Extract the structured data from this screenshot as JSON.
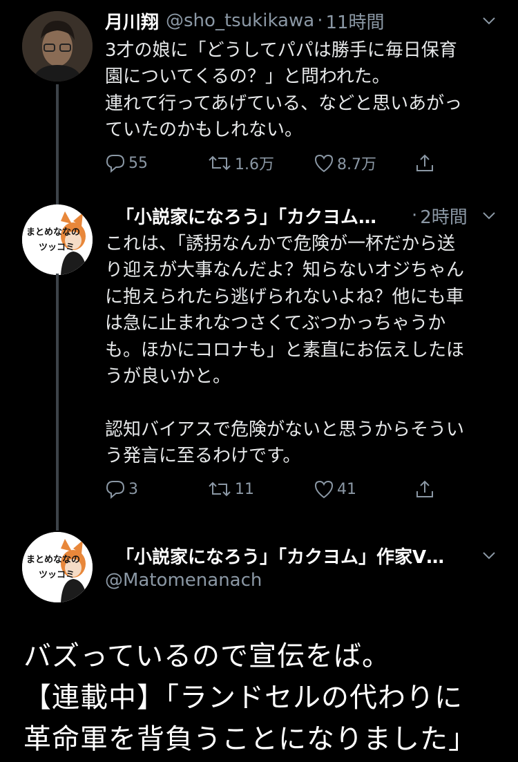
{
  "tweets": [
    {
      "display_name": "月川翔",
      "handle": "@sho_tsukikawa",
      "time": "11時間",
      "body": "3才の娘に「どうしてパパは勝手に毎日保育\n園についてくるの？」と問われた。\n連れて行ってあげている、などと思いあがっ\nていたのかもしれない。",
      "replies": "55",
      "retweets": "1.6万",
      "likes": "8.7万"
    },
    {
      "display_name": "「小説家になろう」「カクヨム…",
      "time": "2時間",
      "body": "これは、「誘拐なんかで危険が一杯だから送\nり迎えが大事なんだよ？知らないオジちゃん\nに抱えられたら逃げられないよね？他にも車\nは急に止まれなつさくてぶつかっちゃうか\nも。ほかにコロナも」と素直にお伝えしたほ\nうが良いかと。\n\n認知バイアスで危険がないと思うからそうい\nう発言に至るわけです。",
      "replies": "3",
      "retweets": "11",
      "likes": "41"
    },
    {
      "display_name": "「小説家になろう」「カクヨム」作家V…",
      "handle": "@Matomenanach"
    }
  ],
  "avatar2": {
    "line1": "まとめななの",
    "line2": "ツッコミ"
  },
  "promo": {
    "text": "バズっているので宣伝をば。\n【連載中】「ランドセルの代わりに\n革命軍を背負うことになりました」"
  },
  "colors": {
    "background": "#000000",
    "text": "#e7e9ea",
    "muted": "#8b98a5",
    "thread_line": "#3d4349",
    "avatar_accent": "#e8873a"
  },
  "icons": [
    "reply-icon",
    "retweet-icon",
    "like-icon",
    "share-icon",
    "chevron-down-icon"
  ]
}
